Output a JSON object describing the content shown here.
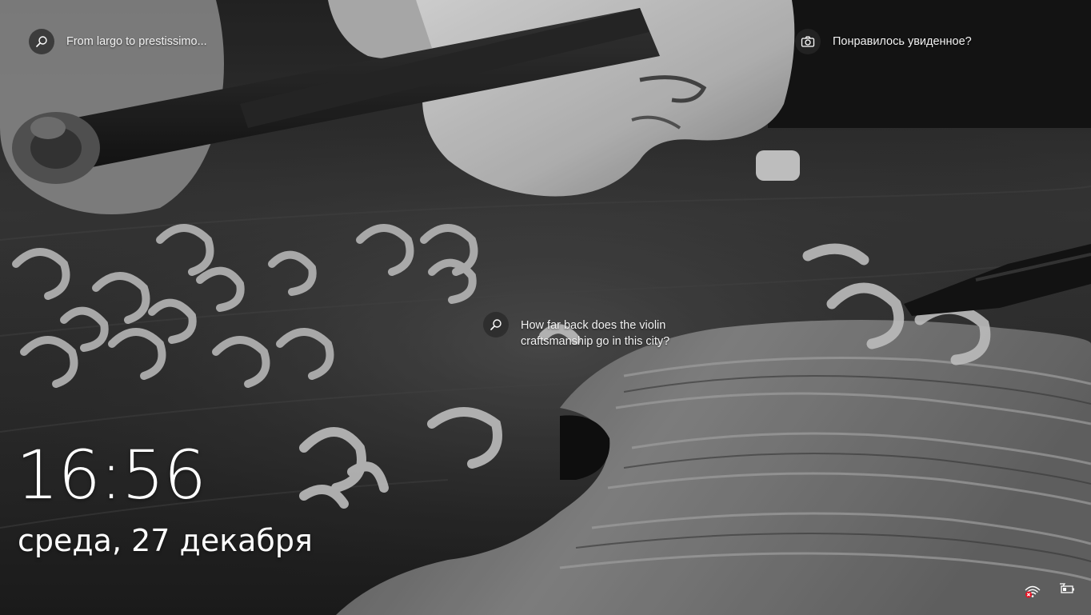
{
  "hotspots": {
    "top_left": {
      "text": "From largo to prestissimo...",
      "icon": "search-icon"
    },
    "top_right": {
      "text": "Понравилось увиденное?",
      "icon": "camera-icon"
    },
    "middle": {
      "text": "How far back does the violin craftsmanship go in this city?",
      "icon": "search-icon"
    }
  },
  "clock": {
    "time": "16:56",
    "date": "среда, 27 декабря"
  },
  "tray": {
    "network_icon": "network-disconnected-icon",
    "battery_icon": "battery-charging-icon"
  },
  "colors": {
    "network_error": "#e81123"
  }
}
